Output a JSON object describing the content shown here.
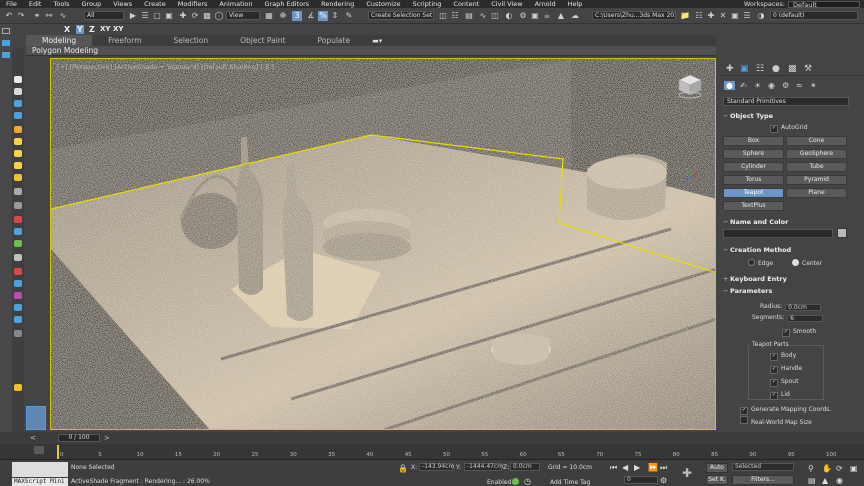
{
  "menu": [
    "File",
    "Edit",
    "Tools",
    "Group",
    "Views",
    "Create",
    "Modifiers",
    "Animation",
    "Graph Editors",
    "Rendering",
    "Customize",
    "Scripting",
    "Content",
    "Civil View",
    "Arnold",
    "Help"
  ],
  "workspaces": {
    "label": "Workspaces:",
    "value": "Default"
  },
  "toolbar": {
    "filter": "All",
    "refcoord": "View",
    "selset": "Create Selection Set",
    "path": "C:\\Users\\Zhu...3ds Max 2022",
    "layer": "0 (default)"
  },
  "axes": [
    "X",
    "Y",
    "Z",
    "XY",
    "XY"
  ],
  "ribbon": {
    "tabs": [
      "Modeling",
      "Freeform",
      "Selection",
      "Object Paint",
      "Populate"
    ],
    "active": "Modeling",
    "sub": "Polygon Modeling"
  },
  "viewport": {
    "label": "[+] [Perspective] [ActiveShade + Standard] [Default Shading] [ β ]"
  },
  "command_panel": {
    "dropdown": "Standard Primitives",
    "object_type": {
      "title": "Object Type",
      "autogrid": "AutoGrid",
      "buttons": [
        "Box",
        "Cone",
        "Sphere",
        "GeoSphere",
        "Cylinder",
        "Tube",
        "Torus",
        "Pyramid",
        "Teapot",
        "Plane",
        "TextPlus"
      ],
      "active": "Teapot"
    },
    "name_color": {
      "title": "Name and Color"
    },
    "creation_method": {
      "title": "Creation Method",
      "edge": "Edge",
      "center": "Center"
    },
    "keyboard_entry": {
      "title": "Keyboard Entry"
    },
    "parameters": {
      "title": "Parameters",
      "radius_label": "Radius:",
      "radius": "0.0cm",
      "segments_label": "Segments:",
      "segments": "6",
      "smooth": "Smooth",
      "teapot_parts": "Teapot Parts",
      "parts": [
        "Body",
        "Handle",
        "Spout",
        "Lid"
      ],
      "gen_map": "Generate Mapping Coords.",
      "real_world": "Real-World Map Size"
    }
  },
  "timeline": {
    "frame": "0 / 100",
    "ticks": [
      "0",
      "5",
      "10",
      "15",
      "20",
      "25",
      "30",
      "35",
      "40",
      "45",
      "50",
      "55",
      "60",
      "65",
      "70",
      "75",
      "80",
      "85",
      "90",
      "95",
      "100"
    ]
  },
  "status": {
    "maxscript": "MAXScript Mini",
    "selected": "None Selected",
    "fragment": "ActiveShade Fragment : Rendering... : 26.00%",
    "x_label": "X:",
    "x": "-143.94cm",
    "y_label": "Y:",
    "y": "-1444.47cm",
    "z_label": "Z:",
    "z": "0.0cm",
    "grid": "Grid = 10.0cm",
    "enabled": "Enabled:",
    "add_time_tag": "Add Time Tag",
    "auto": "Auto",
    "selected_drop": "Selected",
    "setk": "Set K.",
    "filters": "Filters...",
    "frame_field": "0"
  }
}
